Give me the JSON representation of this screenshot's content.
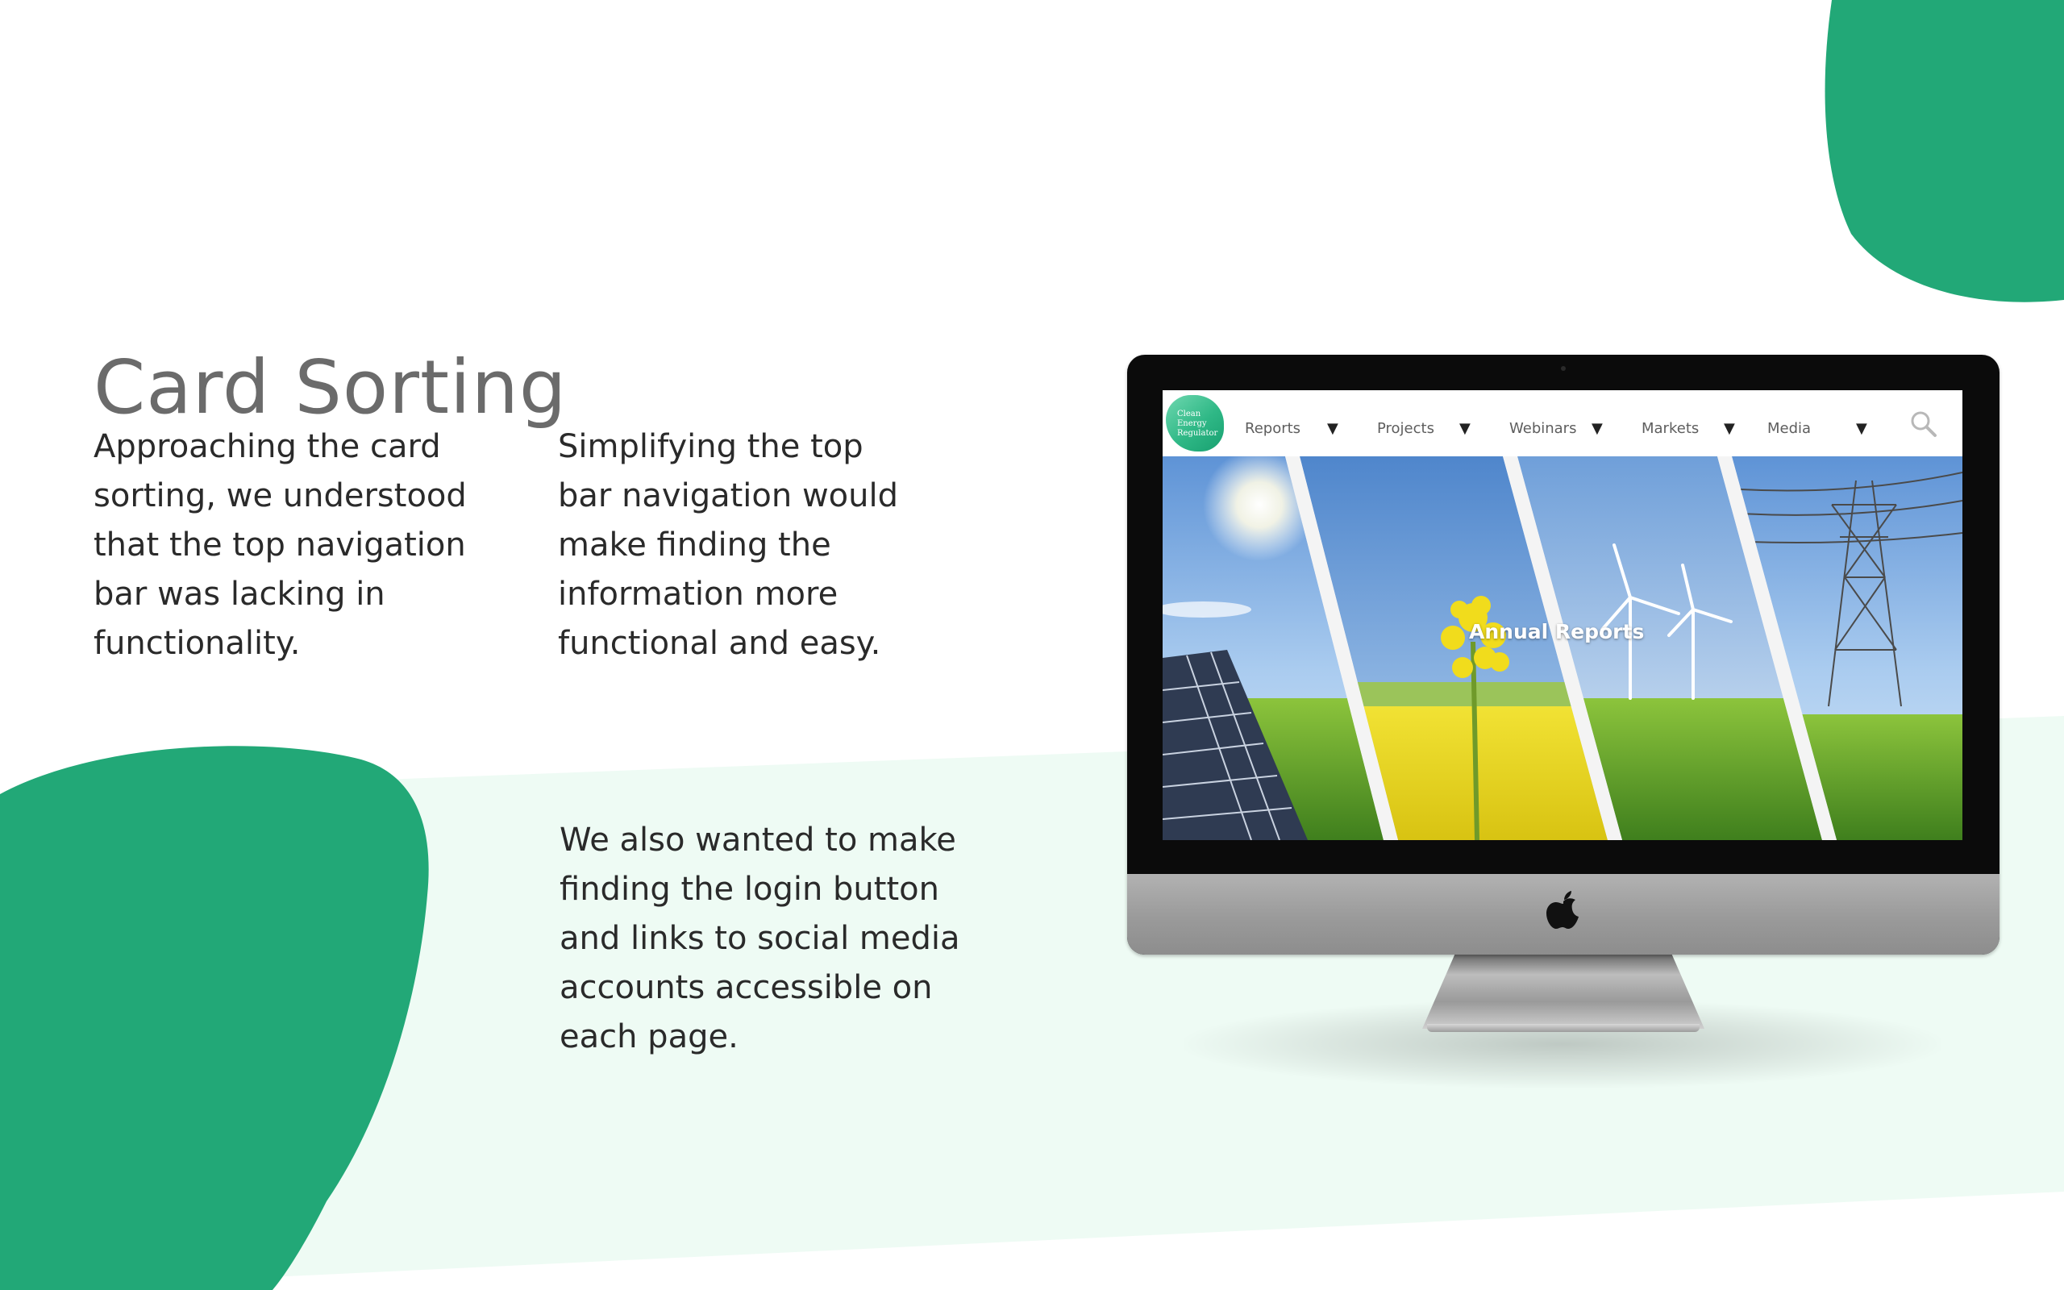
{
  "slide": {
    "title": "Card Sorting",
    "paragraph_1": [
      "Approaching  the card",
      "sorting, we understood",
      "that the top navigation",
      "bar was lacking in",
      "functionality."
    ],
    "paragraph_2": [
      "Simplifying the top",
      "bar navigation would",
      "make finding the",
      "information more",
      "functional and easy."
    ],
    "paragraph_3": [
      "We also wanted to make",
      "finding the login button",
      "and links to social media",
      "accounts accessible on",
      "each page."
    ]
  },
  "website": {
    "logo_text": [
      "Clean",
      "Energy",
      "Regulator"
    ],
    "nav": [
      {
        "label": "Reports"
      },
      {
        "label": "Projects"
      },
      {
        "label": "Webinars"
      },
      {
        "label": "Markets"
      },
      {
        "label": "Media"
      }
    ],
    "dropdown_glyph": "▼",
    "banner_title": "Annual Reports"
  },
  "colors": {
    "brand_green": "#22a877",
    "light_mint": "#eefbf4",
    "title_gray": "#6b6b6b",
    "body_text": "#2a2a2a",
    "nav_text": "#5e5e5e"
  },
  "icons": {
    "search": "search-icon",
    "dropdown": "caret-down-icon",
    "device_logo": "apple-logo-icon"
  }
}
